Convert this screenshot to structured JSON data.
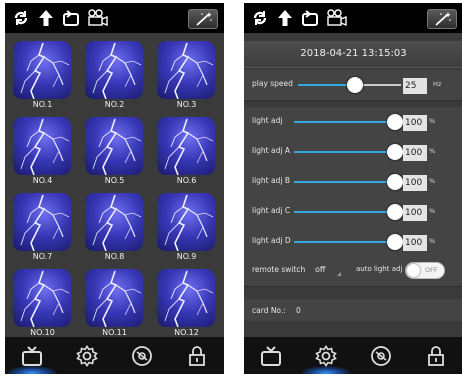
{
  "icons": {
    "top": [
      "refresh-icon",
      "upload-arrow-icon",
      "repeat-icon",
      "camera-icon",
      "magic-wand-icon"
    ],
    "bottom": [
      "tv-icon",
      "gear-icon",
      "disc-icon",
      "lock-icon"
    ]
  },
  "colors": {
    "accent": "#33a8e0",
    "panel": "#2b2b2b",
    "bar": "#000000",
    "tile": "#3838b8"
  },
  "left": {
    "tiles": [
      "NO.1",
      "NO.2",
      "NO.3",
      "NO.4",
      "NO.5",
      "NO.6",
      "NO.7",
      "NO.8",
      "NO.9",
      "NO.10",
      "NO.11",
      "NO.12"
    ],
    "active_tab": 0
  },
  "right": {
    "datetime": "2018-04-21 13:15:03",
    "play_speed": {
      "label": "play speed",
      "value": "25",
      "unit": "Hz",
      "level": 0.55
    },
    "sliders": [
      {
        "label": "light adj",
        "value": "100",
        "unit": "%",
        "level": 1.0
      },
      {
        "label": "light adj A",
        "value": "100",
        "unit": "%",
        "level": 1.0
      },
      {
        "label": "light adj B",
        "value": "100",
        "unit": "%",
        "level": 1.0
      },
      {
        "label": "light adj C",
        "value": "100",
        "unit": "%",
        "level": 1.0
      },
      {
        "label": "light adj D",
        "value": "100",
        "unit": "%",
        "level": 1.0
      }
    ],
    "remote_switch": {
      "label": "remote switch",
      "value": "off"
    },
    "auto_light": {
      "label": "auto light adj",
      "toggle": "OFF"
    },
    "card": {
      "label": "card No.:",
      "value": "0"
    },
    "active_tab": 1
  }
}
